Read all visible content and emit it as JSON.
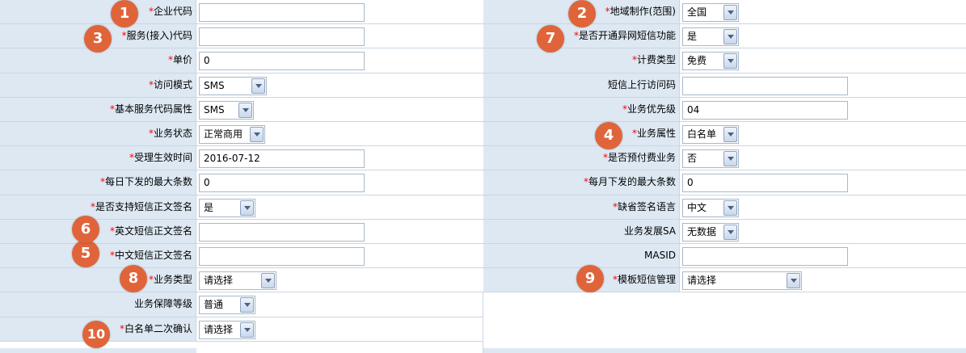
{
  "left": [
    {
      "label": "企业代码",
      "required": true,
      "type": "text",
      "value": ""
    },
    {
      "label": "服务(接入)代码",
      "required": true,
      "type": "text",
      "value": ""
    },
    {
      "label": "单价",
      "required": true,
      "type": "text",
      "value": "0"
    },
    {
      "label": "访问模式",
      "required": true,
      "type": "select",
      "value": "SMS"
    },
    {
      "label": "基本服务代码属性",
      "required": true,
      "type": "select",
      "value": "SMS"
    },
    {
      "label": "业务状态",
      "required": true,
      "type": "select",
      "value": "正常商用"
    },
    {
      "label": "受理生效时间",
      "required": true,
      "type": "text",
      "value": "2016-07-12"
    },
    {
      "label": "每日下发的最大条数",
      "required": true,
      "type": "text",
      "value": "0"
    },
    {
      "label": "是否支持短信正文签名",
      "required": true,
      "type": "select",
      "value": "是"
    },
    {
      "label": "英文短信正文签名",
      "required": true,
      "type": "text",
      "value": ""
    },
    {
      "label": "中文短信正文签名",
      "required": true,
      "type": "text",
      "value": ""
    },
    {
      "label": "业务类型",
      "required": true,
      "type": "select",
      "value": "请选择"
    },
    {
      "label": "业务保障等级",
      "required": false,
      "type": "select",
      "value": "普通"
    },
    {
      "label": "白名单二次确认",
      "required": true,
      "type": "select",
      "value": "请选择"
    }
  ],
  "right": [
    {
      "label": "地域制作(范围)",
      "required": true,
      "type": "select",
      "value": "全国"
    },
    {
      "label": "是否开通异网短信功能",
      "required": true,
      "type": "select",
      "value": "是"
    },
    {
      "label": "计费类型",
      "required": true,
      "type": "select",
      "value": "免费"
    },
    {
      "label": "短信上行访问码",
      "required": false,
      "type": "text",
      "value": ""
    },
    {
      "label": "业务优先级",
      "required": true,
      "type": "text",
      "value": "04"
    },
    {
      "label": "业务属性",
      "required": true,
      "type": "select",
      "value": "白名单"
    },
    {
      "label": "是否预付费业务",
      "required": true,
      "type": "select",
      "value": "否"
    },
    {
      "label": "每月下发的最大条数",
      "required": true,
      "type": "text",
      "value": "0"
    },
    {
      "label": "缺省签名语言",
      "required": true,
      "type": "select",
      "value": "中文"
    },
    {
      "label": "业务发展SA",
      "required": false,
      "type": "select",
      "value": "无数据"
    },
    {
      "label": "MASID",
      "required": false,
      "type": "text",
      "value": ""
    },
    {
      "label": "模板短信管理",
      "required": true,
      "type": "select",
      "value": "请选择"
    }
  ],
  "badges": [
    {
      "number": "1"
    },
    {
      "number": "2"
    },
    {
      "number": "3"
    },
    {
      "number": "4"
    },
    {
      "number": "5"
    },
    {
      "number": "6"
    },
    {
      "number": "7"
    },
    {
      "number": "8"
    },
    {
      "number": "9"
    },
    {
      "number": "10"
    }
  ],
  "colors": {
    "label_bg": "#dde8f3",
    "required_star": "#ff0000",
    "badge": "#e0643a"
  }
}
